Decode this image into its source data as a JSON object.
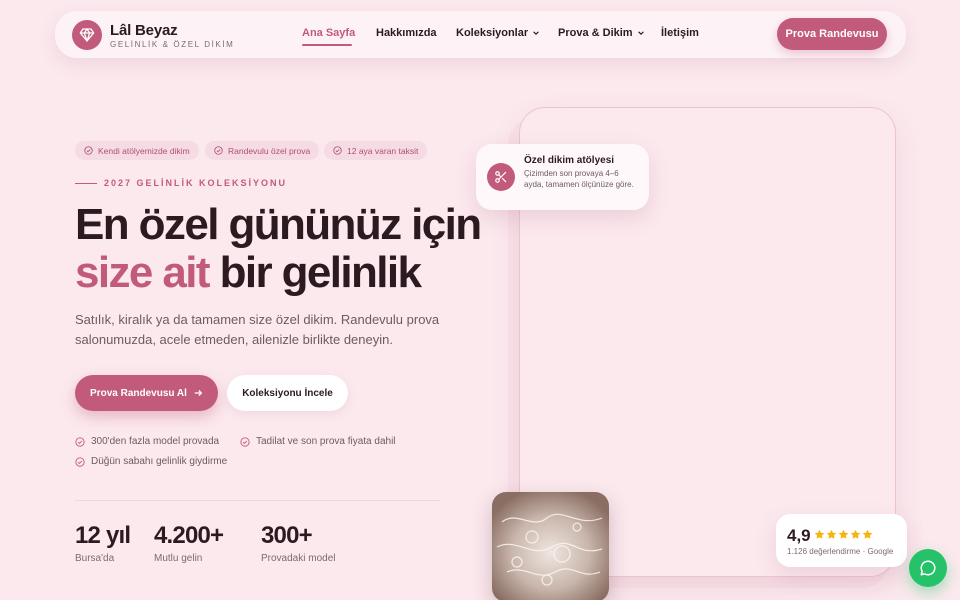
{
  "brand": {
    "name": "Lâl Beyaz",
    "tagline": "GELİNLİK & ÖZEL DİKİM",
    "logo_icon": "diamond-icon"
  },
  "nav": {
    "links": [
      {
        "label": "Ana Sayfa",
        "active": true
      },
      {
        "label": "Hakkımızda"
      },
      {
        "label": "Koleksiyonlar",
        "dropdown": true
      },
      {
        "label": "Prova & Dikim",
        "dropdown": true
      },
      {
        "label": "İletişim"
      }
    ],
    "cta": "Prova Randevusu"
  },
  "hero": {
    "pills": [
      "Kendi atölyemizde dikim",
      "Randevulu özel prova",
      "12 aya varan taksit"
    ],
    "eyebrow": "2027 GELİNLİK KOLEKSİYONU",
    "title_line1": "En özel gününüz için",
    "title_accent": "size ait",
    "title_rest": " bir gelinlik",
    "lede": "Satılık, kiralık ya da tamamen size özel dikim. Randevulu prova salonumuzda, acele etmeden, ailenizle birlikte deneyin.",
    "primary_cta": "Prova Randevusu Al",
    "secondary_cta": "Koleksiyonu İncele",
    "checks": [
      "300'den fazla model provada",
      "Tadilat ve son prova fiyata dahil",
      "Düğün sabahı gelinlik giydirme"
    ],
    "stats": [
      {
        "value": "12 yıl",
        "label": "Bursa'da"
      },
      {
        "value": "4.200+",
        "label": "Mutlu gelin"
      },
      {
        "value": "300+",
        "label": "Provadaki model"
      }
    ]
  },
  "feature_card": {
    "icon": "scissors-icon",
    "title": "Özel dikim atölyesi",
    "desc": "Çizimden son provaya 4–6 ayda, tamamen ölçünüze göre."
  },
  "rating": {
    "score": "4,9",
    "stars": 5,
    "sub": "1.126 değerlendirme · Google"
  },
  "colors": {
    "accent": "#c25a7c",
    "background": "#fbe9ee",
    "text": "#2b1a20",
    "chat": "#25c26a",
    "star": "#f5b50a"
  }
}
